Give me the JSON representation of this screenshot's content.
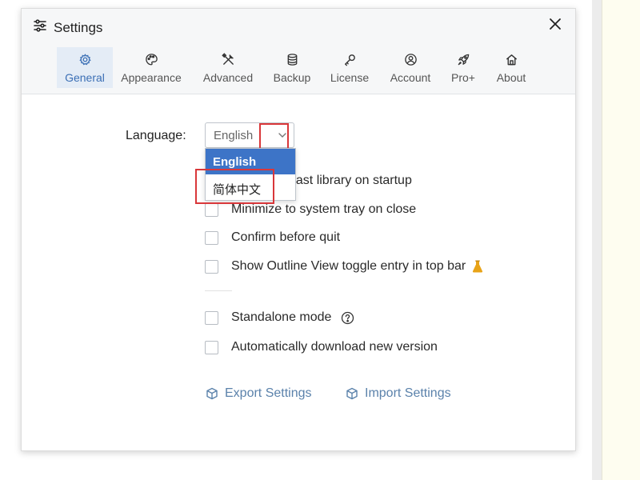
{
  "dialog": {
    "title": "Settings",
    "close_icon": "close-icon"
  },
  "tabs": [
    {
      "id": "general",
      "label": "General",
      "icon": "gear-icon",
      "active": true
    },
    {
      "id": "appearance",
      "label": "Appearance",
      "icon": "palette-icon",
      "active": false
    },
    {
      "id": "advanced",
      "label": "Advanced",
      "icon": "tools-icon",
      "active": false
    },
    {
      "id": "backup",
      "label": "Backup",
      "icon": "database-icon",
      "active": false
    },
    {
      "id": "license",
      "label": "License",
      "icon": "key-icon",
      "active": false
    },
    {
      "id": "account",
      "label": "Account",
      "icon": "user-circle-icon",
      "active": false
    },
    {
      "id": "pro",
      "label": "Pro+",
      "icon": "rocket-icon",
      "active": false
    },
    {
      "id": "about",
      "label": "About",
      "icon": "home-icon",
      "active": false
    }
  ],
  "language": {
    "label": "Language:",
    "selected": "English",
    "options": [
      "English",
      "简体中文"
    ]
  },
  "options": {
    "open_last": "e last library on startup",
    "minimize": "Minimize to system tray on close",
    "confirm_quit": "Confirm before quit",
    "outline_toggle": "Show Outline View toggle entry in top bar",
    "standalone": "Standalone mode",
    "auto_download": "Automatically download new version"
  },
  "actions": {
    "export": "Export Settings",
    "import": "Import Settings"
  },
  "colors": {
    "accent": "#3b6fb5",
    "highlight": "#d9373a",
    "selected_option": "#3d74c7",
    "flask": "#e8a317"
  }
}
